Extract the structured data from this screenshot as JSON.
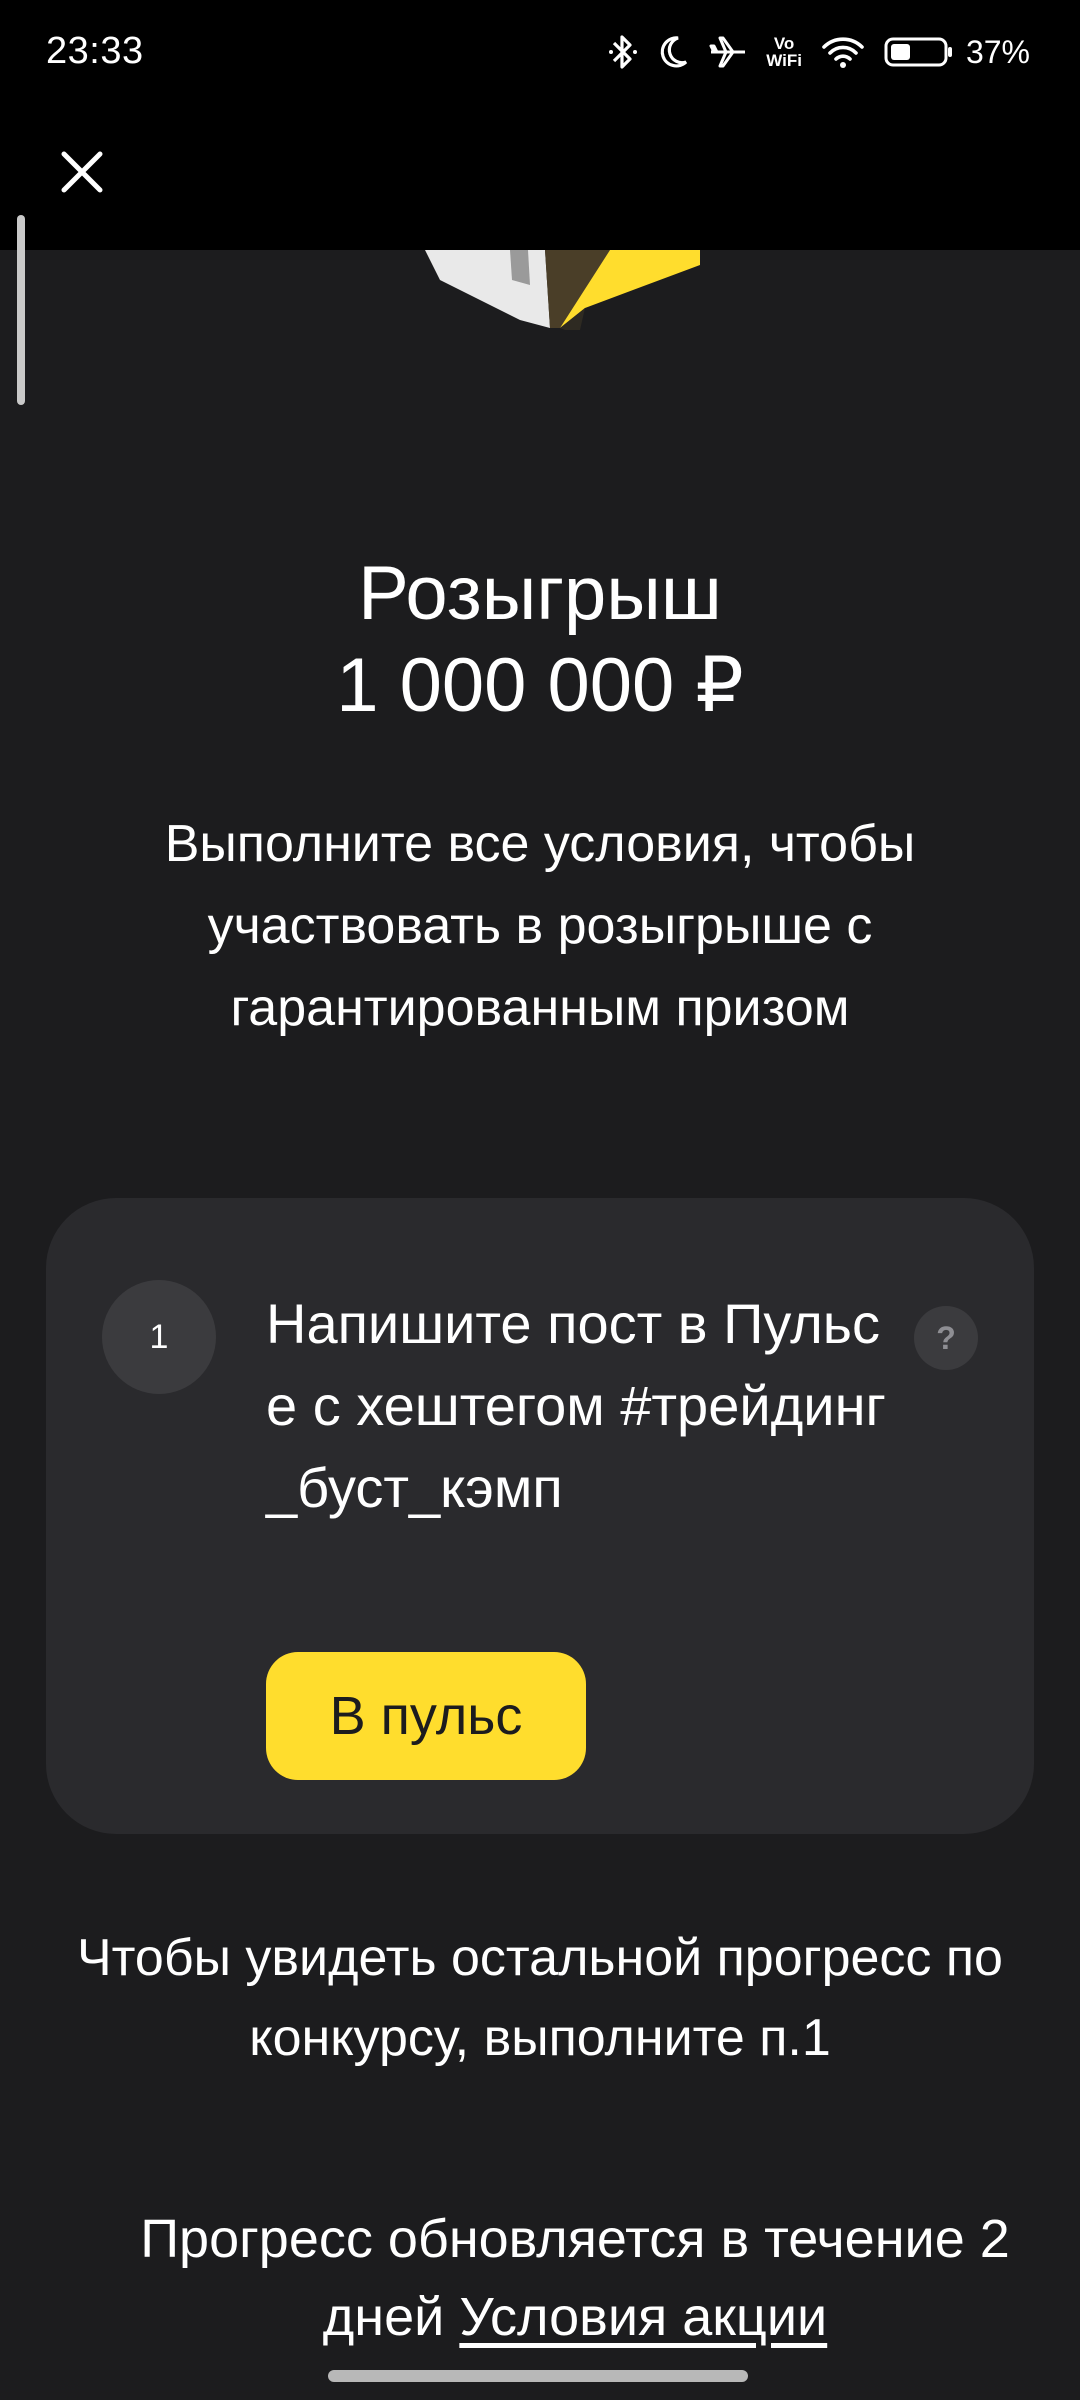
{
  "status_bar": {
    "time": "23:33",
    "battery_percent": "37%",
    "icons": [
      "bluetooth-icon",
      "moon-icon",
      "airplane-icon",
      "vowifi-icon",
      "wifi-icon",
      "battery-icon"
    ],
    "vowifi_top": "Vo",
    "vowifi_bottom": "WiFi"
  },
  "header": {
    "close_icon": "close-icon"
  },
  "main": {
    "title_line1": "Розыгрыш",
    "title_line2": "1 000 000 ₽",
    "subtitle": "Выполните все условия, чтобы участвовать в розыгрыше с гарантированным призом"
  },
  "task_card": {
    "step_number": "1",
    "text": "Напишите пост в Пульсе с хештегом #трейдинг_буст_кэмп",
    "help_icon": "?",
    "button_label": "В пульс"
  },
  "info_text": "Чтобы увидеть остальной прогресс по конкурсу, выполните п.1",
  "progress_note": {
    "text": "Прогресс обновляется в течение 2 дней",
    "terms_link": "Условия акции"
  },
  "colors": {
    "background": "#1c1c1e",
    "card": "#2a2a2d",
    "accent": "#ffdd2d"
  }
}
